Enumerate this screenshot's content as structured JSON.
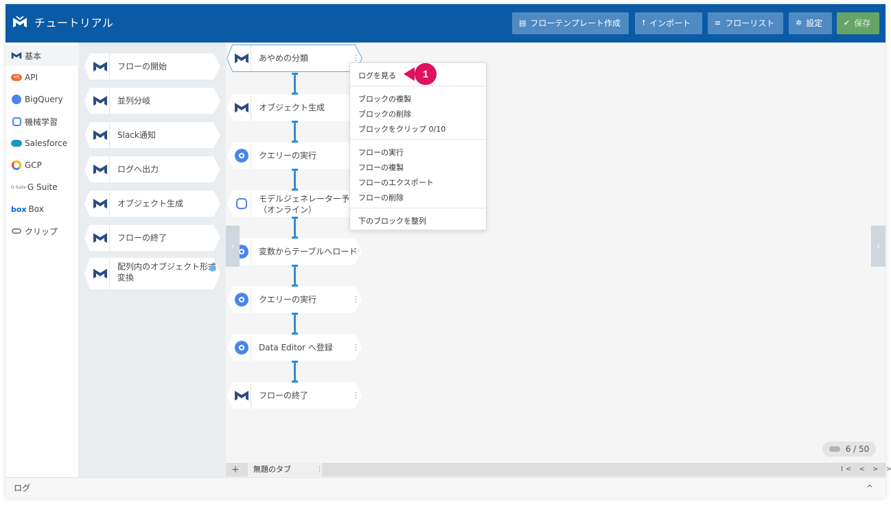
{
  "header": {
    "title": "チュートリアル",
    "buttons": {
      "template": "フローテンプレート作成",
      "import": "インポート",
      "flowlist": "フローリスト",
      "settings": "設定",
      "save": "保存"
    }
  },
  "categories": [
    {
      "label": "基本",
      "icon": "logo-icon"
    },
    {
      "label": "API",
      "icon": "api-cloud-icon"
    },
    {
      "label": "BigQuery",
      "icon": "bigquery-icon"
    },
    {
      "label": "機械学習",
      "icon": "brain-icon"
    },
    {
      "label": "Salesforce",
      "icon": "salesforce-cloud-icon"
    },
    {
      "label": "GCP",
      "icon": "gcp-hexagon-icon"
    },
    {
      "label": "G Suite",
      "icon": "gsuite-icon"
    },
    {
      "label": "Box",
      "icon": "box-icon"
    },
    {
      "label": "クリップ",
      "icon": "clip-icon"
    }
  ],
  "category_icon_text": {
    "api": "API",
    "gsuite": "G Suite",
    "box": "box"
  },
  "palette": [
    {
      "label": "フローの開始"
    },
    {
      "label": "並列分岐"
    },
    {
      "label": "Slack通知"
    },
    {
      "label": "ログへ出力"
    },
    {
      "label": "オブジェクト生成"
    },
    {
      "label": "フローの終了"
    },
    {
      "label_line1": "配列内のオブジェクト形式",
      "label_line2": "変換"
    }
  ],
  "flow": [
    {
      "label": "あやめの分類",
      "icon": "logo-icon"
    },
    {
      "label": "オブジェクト生成",
      "icon": "logo-icon"
    },
    {
      "label": "クエリーの実行",
      "icon": "bigquery-icon"
    },
    {
      "label_line1": "モデルジェネレーター予測",
      "label_line2": "（オンライン）",
      "icon": "brain-icon"
    },
    {
      "label": "変数からテーブルへロード",
      "icon": "bigquery-icon"
    },
    {
      "label": "クエリーの実行",
      "icon": "bigquery-icon"
    },
    {
      "label": "Data Editor へ登録",
      "icon": "bigquery-icon"
    },
    {
      "label": "フローの終了",
      "icon": "logo-icon"
    }
  ],
  "node_menu_glyph": "⋮",
  "context_menu": {
    "view_log": "ログを見る",
    "duplicate_block": "ブロックの複製",
    "delete_block": "ブロックの削除",
    "clip_block": "ブロックをクリップ 0/10",
    "run_flow": "フローの実行",
    "duplicate_flow": "フローの複製",
    "export_flow": "フローのエクスポート",
    "delete_flow": "フローの削除",
    "align_below": "下のブロックを整列"
  },
  "callout_number": "1",
  "counter": "6 / 50",
  "tabs": {
    "add": "+",
    "items": [
      {
        "label": "無題のタブ"
      }
    ],
    "nav": "I< < > >I"
  },
  "log": {
    "label": "ログ",
    "toggle": "^"
  },
  "colors": {
    "header": "#0b5aa6",
    "header_button": "#4f8ac2",
    "save_button": "#66a566",
    "connector": "#2c8ed6",
    "callout": "#e0115f",
    "bigquery": "#4a86e8",
    "api": "#f26b3a",
    "salesforce": "#1798c1"
  }
}
